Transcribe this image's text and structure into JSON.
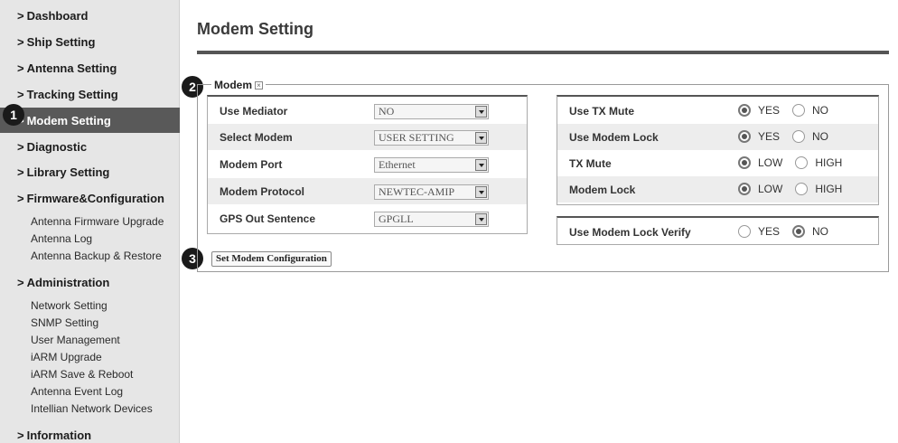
{
  "sidebar": {
    "items": [
      {
        "label": "Dashboard"
      },
      {
        "label": "Ship Setting"
      },
      {
        "label": "Antenna Setting"
      },
      {
        "label": "Tracking Setting"
      },
      {
        "label": "Modem Setting",
        "active": true
      },
      {
        "label": "Diagnostic"
      },
      {
        "label": "Library Setting"
      },
      {
        "label": "Firmware&Configuration"
      },
      {
        "label": "Administration"
      },
      {
        "label": "Information"
      }
    ],
    "firmware_sub": [
      "Antenna Firmware Upgrade",
      "Antenna Log",
      "Antenna Backup & Restore"
    ],
    "admin_sub": [
      "Network Setting",
      "SNMP Setting",
      "User Management",
      "iARM Upgrade",
      "iARM Save & Reboot",
      "Antenna Event Log",
      "Intellian Network Devices"
    ]
  },
  "badges": [
    "1",
    "2",
    "3"
  ],
  "main": {
    "title": "Modem Setting",
    "section_legend": "Modem",
    "left_rows": [
      {
        "label": "Use Mediator",
        "value": "NO"
      },
      {
        "label": "Select Modem",
        "value": "USER SETTING"
      },
      {
        "label": "Modem Port",
        "value": "Ethernet"
      },
      {
        "label": "Modem Protocol",
        "value": "NEWTEC-AMIP"
      },
      {
        "label": "GPS Out Sentence",
        "value": "GPGLL"
      }
    ],
    "right_rows": [
      {
        "label": "Use TX Mute",
        "opt1": "YES",
        "opt2": "NO",
        "selected": 1
      },
      {
        "label": "Use Modem Lock",
        "opt1": "YES",
        "opt2": "NO",
        "selected": 1
      },
      {
        "label": "TX Mute",
        "opt1": "LOW",
        "opt2": "HIGH",
        "selected": 1
      },
      {
        "label": "Modem Lock",
        "opt1": "LOW",
        "opt2": "HIGH",
        "selected": 1
      }
    ],
    "verify_row": {
      "label": "Use Modem Lock Verify",
      "opt1": "YES",
      "opt2": "NO",
      "selected": 2
    },
    "set_button": "Set Modem Configuration"
  },
  "colors": {
    "active_nav": "#595959",
    "sidebar_bg": "#e6e6e6",
    "badge": "#1a1a1a"
  }
}
